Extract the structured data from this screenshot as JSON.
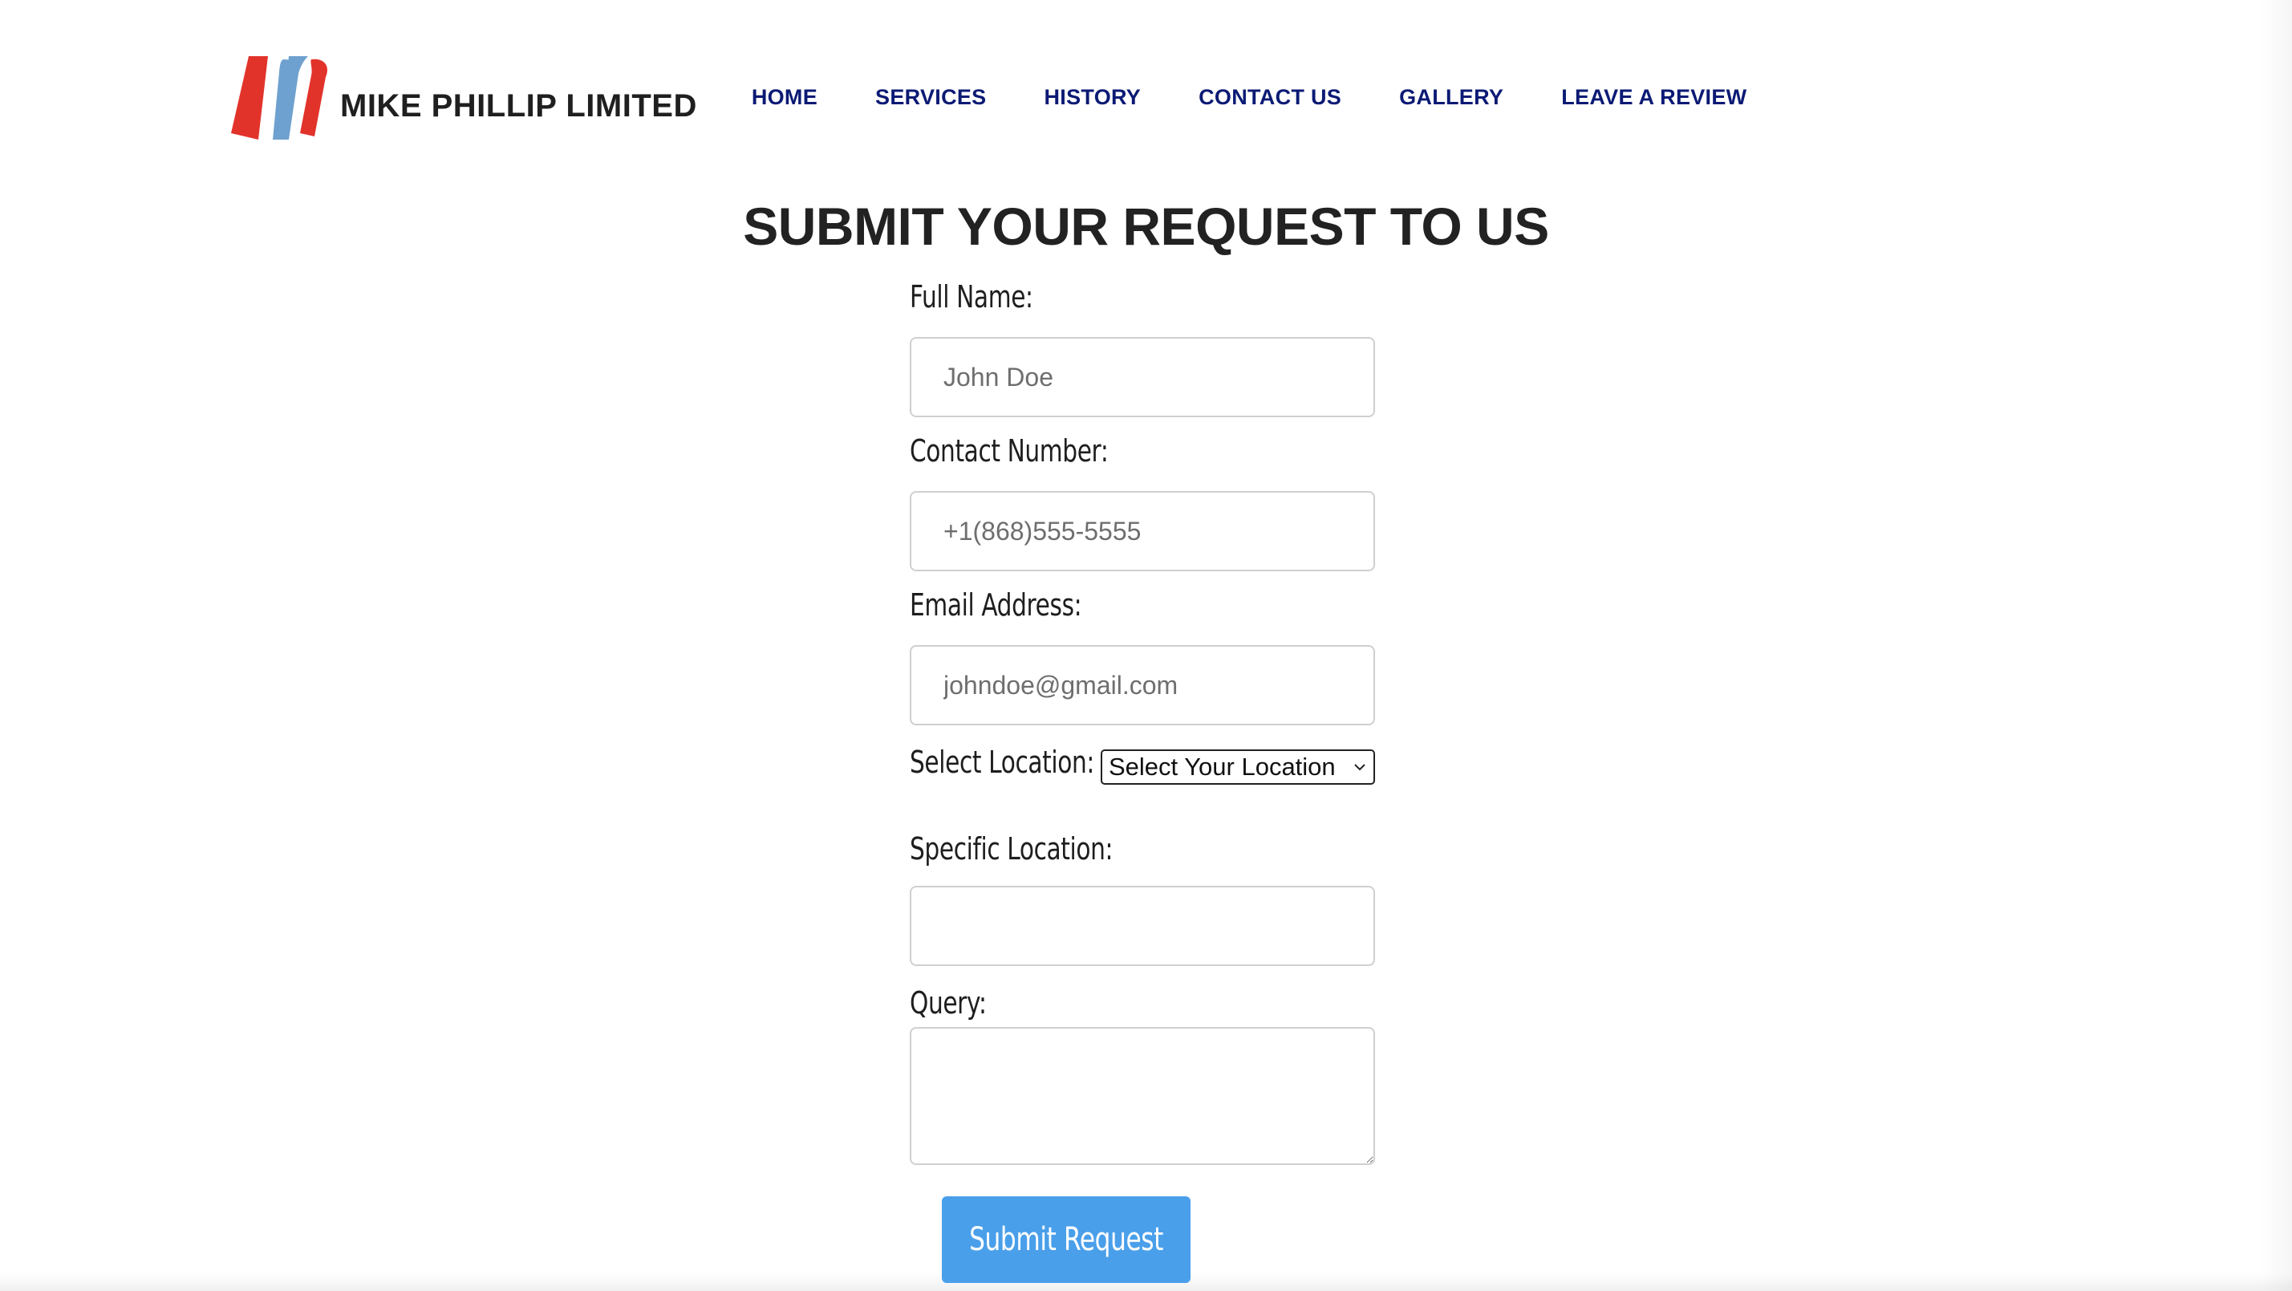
{
  "brand": {
    "name": "MIKE PHILLIP LIMITED",
    "colors": {
      "red": "#e2332b",
      "blue": "#6ea1cf"
    }
  },
  "nav": {
    "items": [
      {
        "label": "HOME"
      },
      {
        "label": "SERVICES"
      },
      {
        "label": "HISTORY"
      },
      {
        "label": "CONTACT US"
      },
      {
        "label": "GALLERY"
      },
      {
        "label": "LEAVE A REVIEW"
      }
    ],
    "color": "#0b1a74"
  },
  "page": {
    "title": "SUBMIT YOUR REQUEST TO US"
  },
  "form": {
    "full_name": {
      "label": "Full Name:",
      "placeholder": "John Doe",
      "value": ""
    },
    "contact_number": {
      "label": "Contact Number:",
      "placeholder": "+1(868)555-5555",
      "value": ""
    },
    "email": {
      "label": "Email Address:",
      "placeholder": "johndoe@gmail.com",
      "value": ""
    },
    "location": {
      "label": "Select Location:",
      "selected": "Select Your Location"
    },
    "specific_location": {
      "label": "Specific Location:",
      "value": ""
    },
    "query": {
      "label": "Query:",
      "value": ""
    },
    "submit_label": "Submit Request",
    "accent": "#4a9fea"
  }
}
